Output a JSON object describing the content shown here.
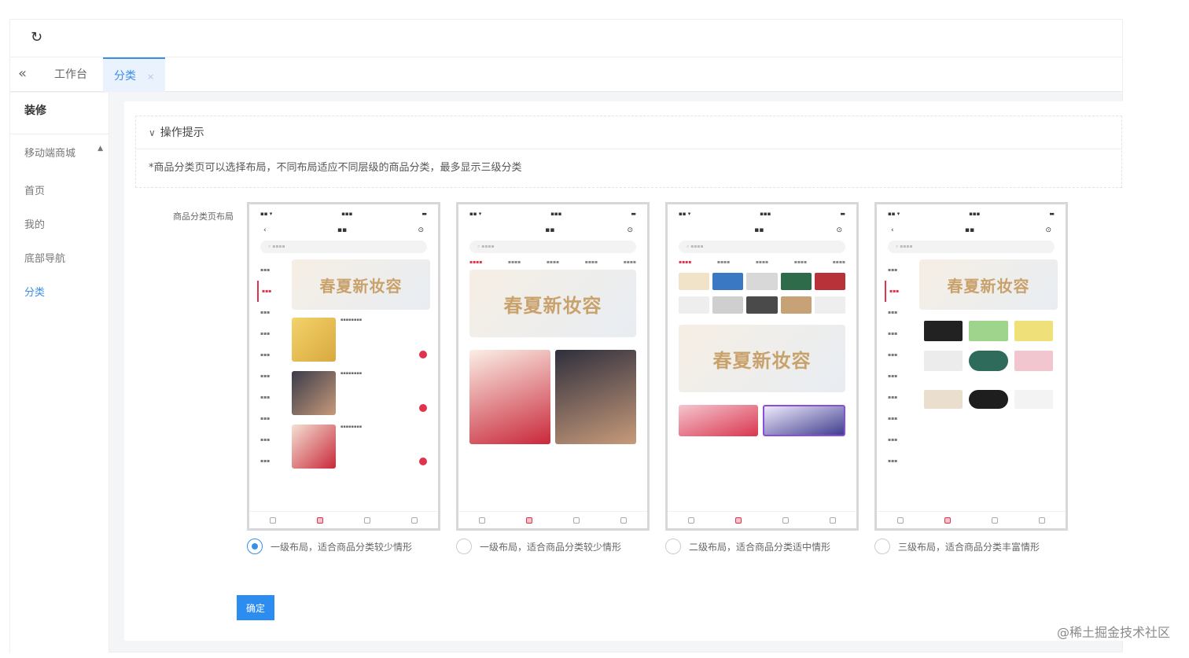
{
  "toolbar": {
    "refresh_icon": "refresh-icon"
  },
  "tabs": {
    "collapse_icon": "double-chevron-left-icon",
    "items": [
      {
        "label": "工作台"
      },
      {
        "label": "分类",
        "close": "×"
      }
    ]
  },
  "sidebar": {
    "title": "装修",
    "group": "移动端商城",
    "group_caret": "▲",
    "items": [
      "首页",
      "我的",
      "底部导航",
      "分类"
    ]
  },
  "tips": {
    "title": "操作提示",
    "text": "*商品分类页可以选择布局，不同布局适应不同层级的商品分类，最多显示三级分类"
  },
  "layout_field": {
    "label": "商品分类页布局"
  },
  "layouts": [
    {
      "label": "一级布局，适合商品分类较少情形",
      "checked": true,
      "banner": "春夏新妆容"
    },
    {
      "label": "一级布局，适合商品分类较少情形",
      "checked": false,
      "banner": "春夏新妆容"
    },
    {
      "label": "二级布局，适合商品分类适中情形",
      "checked": false,
      "banner": "春夏新妆容"
    },
    {
      "label": "三级布局，适合商品分类丰富情形",
      "checked": false,
      "banner": "春夏新妆容"
    }
  ],
  "confirm_label": "确定",
  "watermark": "@稀土掘金技术社区",
  "colors": {
    "accent": "#2d8cf0",
    "brand_red": "#e0334d"
  }
}
